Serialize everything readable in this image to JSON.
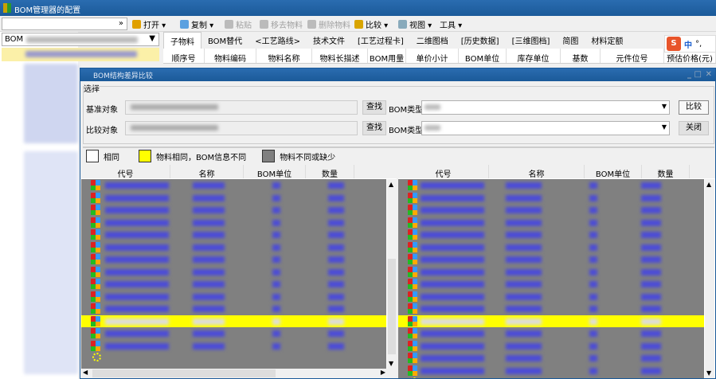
{
  "app": {
    "title": "BOM管理器的配置"
  },
  "toolbar": {
    "open": "打开 ▾",
    "copy": "复制 ▾",
    "paste": "粘贴",
    "remove": "移去物料",
    "delete": "删除物料",
    "compare": "比较 ▾",
    "view": "视图 ▾",
    "tools": "工具 ▾"
  },
  "left": {
    "combo_prefix": "BOM"
  },
  "tabs": [
    "子物料",
    "BOM替代",
    "<工艺路线>",
    "技术文件",
    "[工艺过程卡]",
    "二维图档",
    "[历史数据]",
    "[三维图档]",
    "简图",
    "材料定额"
  ],
  "columns": [
    "顺序号",
    "物料编码",
    "物料名称",
    "物料长描述",
    "BOM用量",
    "单价小计",
    "BOM单位",
    "库存单位",
    "基数",
    "元件位号",
    "预估价格(元)"
  ],
  "ime": {
    "mode": "中",
    "punct": "°,"
  },
  "dialog": {
    "title": "BOM结构差异比较",
    "group": "选择",
    "base_label": "基准对象",
    "compare_label": "比较对象",
    "find": "查找",
    "bom_type": "BOM类型",
    "compare_btn": "比较",
    "close_btn": "关闭"
  },
  "legend": {
    "same": "相同",
    "diff_info": "物料相同，BOM信息不同",
    "missing": "物料不同或缺少"
  },
  "colors": {
    "same": "#ffffff",
    "diff_info": "#ffff00",
    "missing": "#808080"
  },
  "grid": {
    "columns": [
      "代号",
      "名称",
      "BOM单位",
      "数量"
    ],
    "left_rows": 14,
    "right_rows": 16,
    "highlight_row_index": 11
  }
}
